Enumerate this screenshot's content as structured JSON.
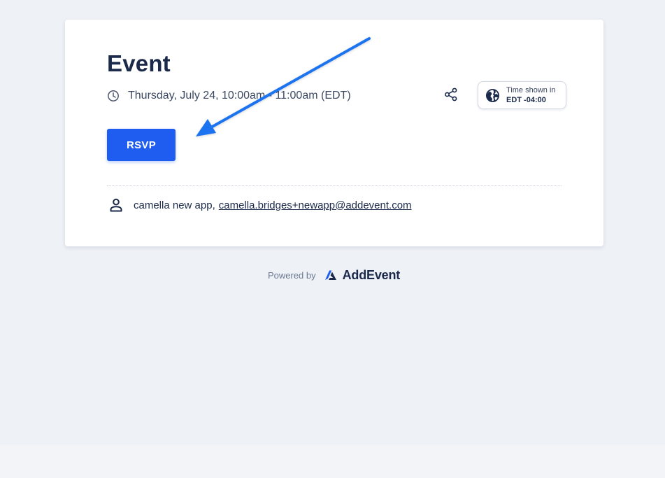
{
  "event": {
    "title": "Event",
    "datetime": "Thursday, July 24, 10:00am - 11:00am (EDT)"
  },
  "timezone": {
    "label": "Time shown in",
    "value": "EDT -04:00"
  },
  "actions": {
    "rsvp_label": "RSVP",
    "share_icon": "share-icon"
  },
  "organizer": {
    "name": "camella new app,",
    "email": "camella.bridges+newapp@addevent.com"
  },
  "footer": {
    "powered_by": "Powered by",
    "brand": "AddEvent"
  },
  "colors": {
    "page_background": "#eef1f6",
    "primary_button": "#1f5cf0",
    "text_dark": "#1b2a4a",
    "annotation_arrow": "#1a73f0"
  }
}
